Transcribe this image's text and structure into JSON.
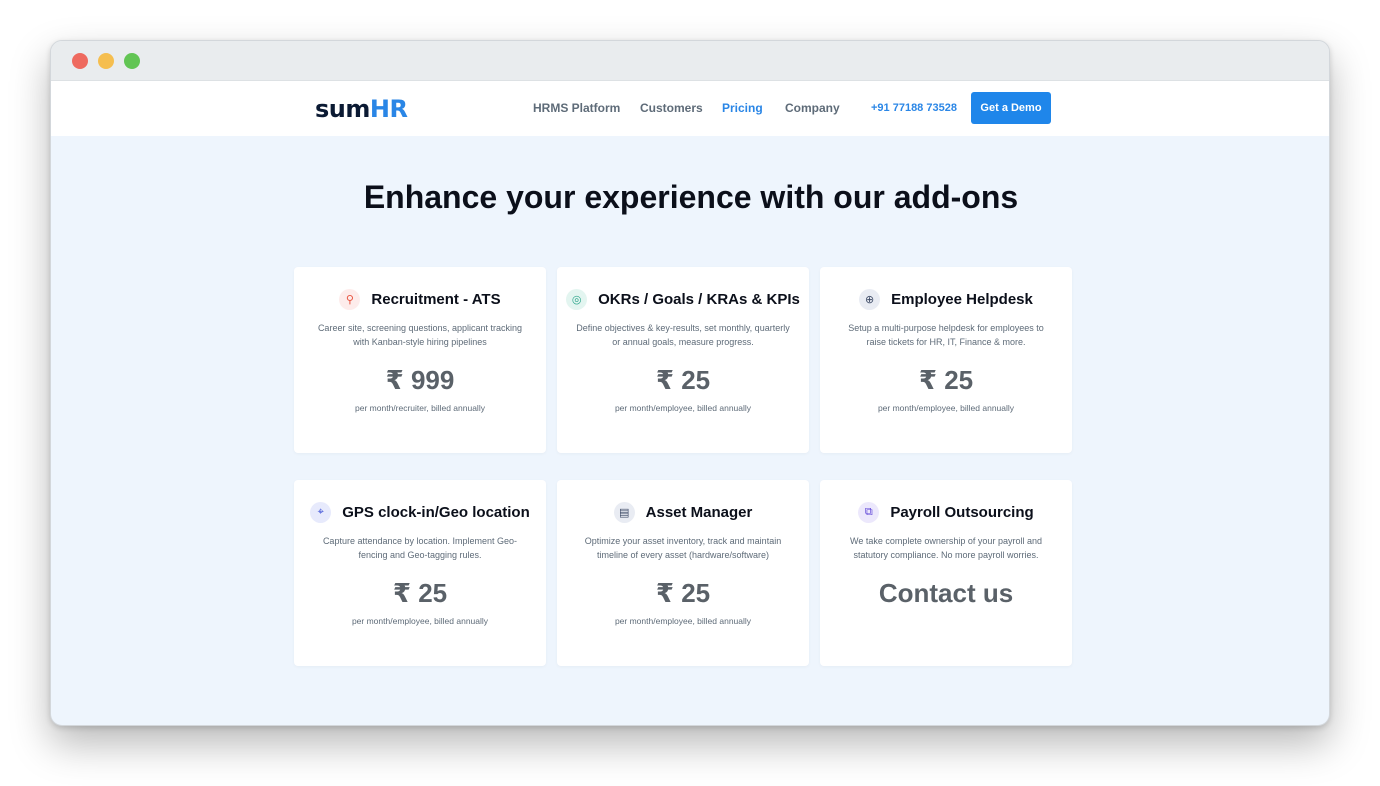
{
  "nav": {
    "logo_part1": "sum",
    "logo_part2": "HR",
    "links": [
      "HRMS Platform",
      "Customers",
      "Pricing",
      "Company"
    ],
    "phone": "+91 77188 73528",
    "cta": "Get a Demo"
  },
  "heading": "Enhance your experience with our add-ons",
  "cards": [
    {
      "title": "Recruitment - ATS",
      "icon": "recruitment-icon",
      "icon_color": "#e8533f",
      "icon_bg": "#fdeceb",
      "description": "Career site, screening questions, applicant tracking with Kanban-style hiring pipelines",
      "price": "₹ 999",
      "billing": "per month/recruiter, billed annually"
    },
    {
      "title": "OKRs / Goals / KRAs & KPIs",
      "icon": "target-icon",
      "icon_color": "#2aa58a",
      "icon_bg": "#e3f5f0",
      "description": "Define objectives & key-results, set monthly, quarterly or annual goals, measure progress.",
      "price": "₹ 25",
      "billing": "per month/employee, billed annually"
    },
    {
      "title": "Employee Helpdesk",
      "icon": "lifebuoy-icon",
      "icon_color": "#3d4a66",
      "icon_bg": "#e9ecf3",
      "description": "Setup a multi-purpose helpdesk for employees to raise tickets for HR, IT, Finance & more.",
      "price": "₹ 25",
      "billing": "per month/employee, billed annually"
    },
    {
      "title": "GPS clock-in/Geo location",
      "icon": "location-icon",
      "icon_color": "#3b4fd6",
      "icon_bg": "#e7eafc",
      "description": "Capture attendance by location. Implement Geo-fencing and Geo-tagging rules.",
      "price": "₹ 25",
      "billing": "per month/employee, billed annually"
    },
    {
      "title": "Asset Manager",
      "icon": "asset-icon",
      "icon_color": "#3d4a66",
      "icon_bg": "#e9ecf3",
      "description": "Optimize your asset inventory, track and maintain timeline of every asset (hardware/software)",
      "price": "₹ 25",
      "billing": "per month/employee, billed annually"
    },
    {
      "title": "Payroll Outsourcing",
      "icon": "payroll-icon",
      "icon_color": "#5a3fd6",
      "icon_bg": "#ece8fc",
      "description": "We take complete ownership of your payroll and statutory compliance. No more payroll worries.",
      "price": "Contact us",
      "billing": ""
    }
  ]
}
